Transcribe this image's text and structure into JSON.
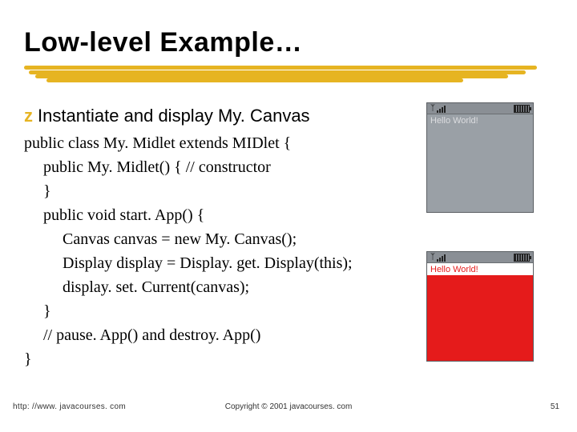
{
  "title": "Low-level Example…",
  "bullet": {
    "marker": "z",
    "text": "Instantiate and display My. Canvas"
  },
  "code": {
    "l0": "public class My. Midlet extends MIDlet {",
    "l1": "public My. Midlet() { // constructor",
    "l2": "}",
    "l3": "public void start. App() {",
    "l4": "Canvas canvas = new My. Canvas();",
    "l5": "Display display = Display. get. Display(this);",
    "l6": "display. set. Current(canvas);",
    "l7": "}",
    "l8": "// pause. App() and destroy. App()",
    "l9": "}"
  },
  "phone_a": {
    "hello": "Hello World!"
  },
  "phone_b": {
    "hello": "Hello World!"
  },
  "footer": {
    "url": "http: //www. javacourses. com",
    "copyright": "Copyright © 2001 javacourses. com",
    "page": "51"
  },
  "colors": {
    "accent": "#e6b422",
    "red": "#e51b1b"
  }
}
